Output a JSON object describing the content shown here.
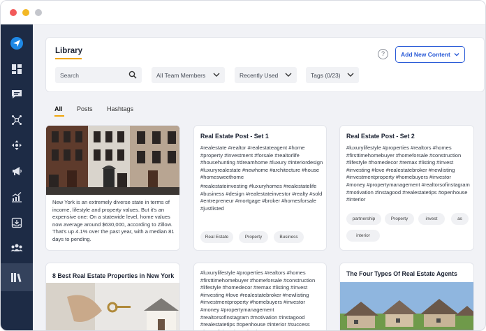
{
  "window": {
    "dots": [
      "#f25a5a",
      "#f3b825",
      "#c4c6cc"
    ]
  },
  "sidebar": {
    "items": [
      {
        "icon": "paper-plane-icon"
      },
      {
        "icon": "dashboard-grid-icon"
      },
      {
        "icon": "message-icon"
      },
      {
        "icon": "network-icon"
      },
      {
        "icon": "move-icon"
      },
      {
        "icon": "megaphone-icon"
      },
      {
        "icon": "analytics-icon"
      },
      {
        "icon": "inbox-download-icon"
      },
      {
        "icon": "team-icon"
      },
      {
        "icon": "library-books-icon",
        "active": true
      }
    ]
  },
  "header": {
    "title": "Library",
    "help_icon": "?",
    "add_button": "Add New Content",
    "search_placeholder": "Search",
    "filters": {
      "team": "All Team Members",
      "sort": "Recently Used",
      "tags": "Tags (0/23)"
    }
  },
  "tabs": [
    "All",
    "Posts",
    "Hashtags"
  ],
  "cards": {
    "c1": {
      "body": "New York is an extremely diverse state in terms of income, lifestyle and property values. But it's an expensive one: On a statewide level, home values now average around $630,000, according to Zillow. That's up 4.1% over the past year, with a median 81 days to pending."
    },
    "c2": {
      "title": "Real Estate Post - Set 1",
      "para1": "#realestate #realtor #realestateagent #home #property #investment #forsale #realtorlife #househunting #dreamhome #luxury #interiordesign #luxuryrealestate #newhome #architecture #house #homesweethome",
      "para2": "#realestateinvesting #luxuryhomes #realestatelife #business #design #realestateinvestor #realty #sold #entrepreneur #mortgage #broker #homesforsale #justlisted",
      "tags": [
        "Real Estate",
        "Property",
        "Business"
      ]
    },
    "c3": {
      "title": "Real Estate Post - Set 2",
      "para1": "#luxurylifestyle #properties #realtors #homes #firsttimehomebuyer #homeforsale #construction #lifestyle #homedecor #remax #listing #invest #investing #love #realestatebroker #newlisting #investmentproperty #homebuyers #investor #money #propertymanagement #realtorsofinstagram #motivation #instagood #realestatetips #openhouse #interior",
      "tags": [
        "partnership",
        "Property",
        "invest",
        "as",
        "interior"
      ]
    },
    "c4": {
      "title": "8 Best Real Estate Properties in New York"
    },
    "c5": {
      "para1": "#luxurylifestyle #properties #realtors #homes #firsttimehomebuyer #homeforsale #construction #lifestyle #homedecor #remax #listing #invest #investing #love #realestatebroker #newlisting #investmentproperty #homebuyers #investor #money #propertymanagement #realtorsofinstagram #motivation #instagood #realestatetips #openhouse #interior #success #luxuryliving #homebuying"
    },
    "c6": {
      "title": "The Four Types Of Real Estate Agents"
    }
  },
  "colors": {
    "accent": "#2a5bd7",
    "underline": "#f0a50b",
    "sidebar": "#1d2b45"
  }
}
